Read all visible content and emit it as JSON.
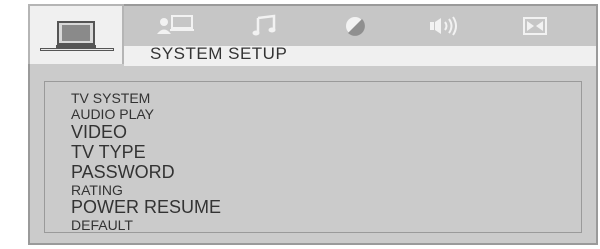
{
  "tabs": [
    {
      "icon": "monitor-icon",
      "active": true
    },
    {
      "icon": "person-monitor-icon",
      "active": false
    },
    {
      "icon": "music-note-icon",
      "active": false
    },
    {
      "icon": "half-circle-icon",
      "active": false
    },
    {
      "icon": "speaker-icon",
      "active": false
    },
    {
      "icon": "bowtie-icon",
      "active": false
    }
  ],
  "header": {
    "title": "SYSTEM SETUP"
  },
  "menu": {
    "items": [
      "TV SYSTEM",
      "AUDIO PLAY",
      "VIDEO",
      "TV TYPE",
      "PASSWORD",
      "RATING",
      "POWER RESUME",
      "DEFAULT"
    ]
  },
  "colors": {
    "panel": "#cbcbcb",
    "active_tab": "#f0f0f0",
    "text": "#333333",
    "icon": "#f2f2f2"
  }
}
